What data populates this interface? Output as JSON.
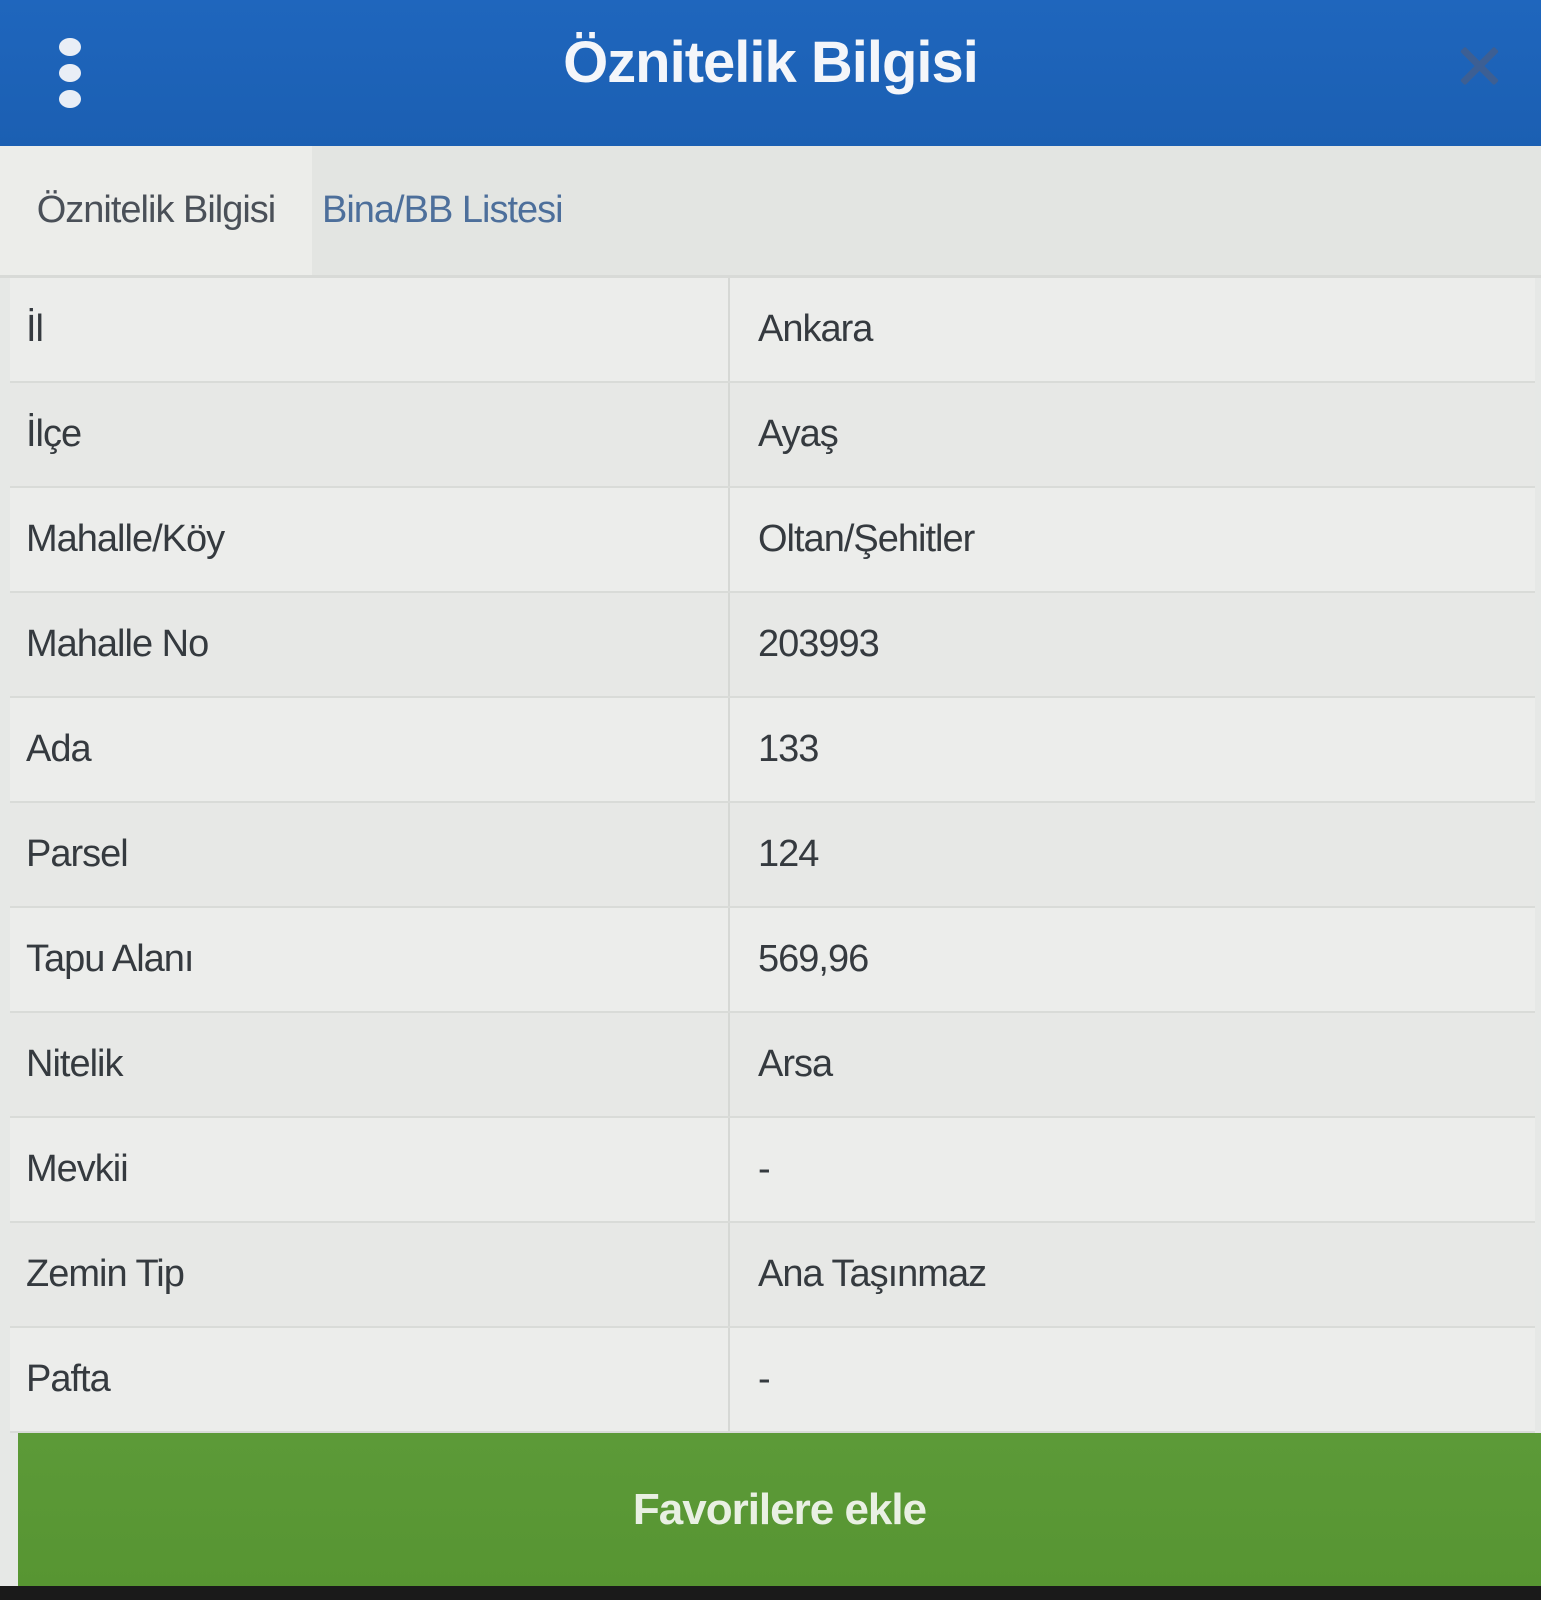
{
  "header": {
    "title": "Öznitelik Bilgisi"
  },
  "tabs": [
    {
      "label": "Öznitelik Bilgisi",
      "active": true
    },
    {
      "label": "Bina/BB Listesi",
      "active": false
    }
  ],
  "attributes": [
    {
      "label": "İl",
      "value": "Ankara"
    },
    {
      "label": "İlçe",
      "value": "Ayaş"
    },
    {
      "label": "Mahalle/Köy",
      "value": "Oltan/Şehitler"
    },
    {
      "label": "Mahalle No",
      "value": "203993"
    },
    {
      "label": "Ada",
      "value": "133"
    },
    {
      "label": "Parsel",
      "value": "124"
    },
    {
      "label": "Tapu Alanı",
      "value": "569,96"
    },
    {
      "label": "Nitelik",
      "value": "Arsa"
    },
    {
      "label": "Mevkii",
      "value": "-"
    },
    {
      "label": "Zemin Tip",
      "value": "Ana Taşınmaz"
    },
    {
      "label": "Pafta",
      "value": "-"
    }
  ],
  "footer": {
    "favorite_button_label": "Favorilere ekle"
  },
  "colors": {
    "header_bg": "#1f66bd",
    "button_bg": "#5c9a38",
    "tab_inactive_text": "#4d6f9b"
  }
}
